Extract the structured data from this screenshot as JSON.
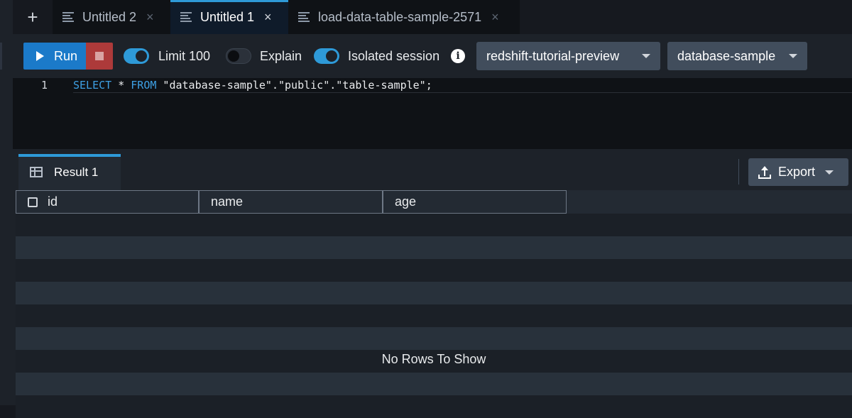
{
  "tabbar": {
    "new_tab_icon": "plus-icon",
    "tabs": [
      {
        "label": "Untitled 2",
        "active": false
      },
      {
        "label": "Untitled 1",
        "active": true
      },
      {
        "label": "load-data-table-sample-2571",
        "active": false
      }
    ]
  },
  "toolbar": {
    "run_label": "Run",
    "limit": {
      "label": "Limit 100",
      "on": true
    },
    "explain": {
      "label": "Explain",
      "on": false
    },
    "isolated": {
      "label": "Isolated session",
      "on": true
    },
    "workgroup": "redshift-tutorial-preview",
    "database": "database-sample"
  },
  "editor": {
    "line_number": "1",
    "kw_select": "SELECT",
    "star": " * ",
    "kw_from": "FROM",
    "rest": " \"database-sample\".\"public\".\"table-sample\";"
  },
  "results": {
    "tab_label": "Result 1",
    "export_label": "Export",
    "columns": [
      "id",
      "name",
      "age"
    ],
    "empty_message": "No Rows To Show"
  },
  "colors": {
    "accent": "#2e9ad8",
    "run_button": "#1b7ac9",
    "stop_button": "#ad3a3a",
    "sql_keyword": "#3ea0e4"
  }
}
